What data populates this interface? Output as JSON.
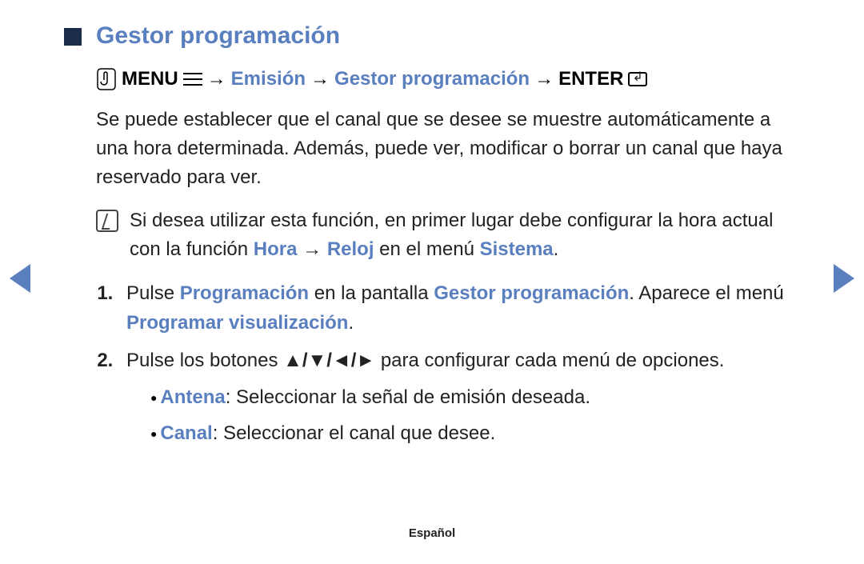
{
  "title": "Gestor programación",
  "path": {
    "menu": "MENU",
    "step1": "Emisión",
    "step2": "Gestor programación",
    "enter": "ENTER",
    "arrow": "→"
  },
  "intro": "Se puede establecer que el canal que se desee se muestre automáticamente a una hora determinada. Además, puede ver, modificar o borrar un canal que haya reservado para ver.",
  "note": {
    "pre": "Si desea utilizar esta función, en primer lugar debe configurar la hora actual con la función ",
    "hora": "Hora",
    "arrow": "→",
    "reloj": "Reloj",
    "mid": " en el menú ",
    "sistema": "Sistema",
    "end": "."
  },
  "steps": {
    "s1": {
      "t1": "Pulse ",
      "prog": "Programación",
      "t2": " en la pantalla ",
      "gestor": "Gestor programación",
      "t3": ". Aparece el menú ",
      "pv": "Programar visualización",
      "t4": "."
    },
    "s2": {
      "t1": "Pulse los botones ",
      "arrows": "▲/▼/◄/►",
      "t2": " para configurar cada menú de opciones."
    }
  },
  "bullets": {
    "antena_label": "Antena",
    "antena_text": ": Seleccionar la señal de emisión deseada.",
    "canal_label": "Canal",
    "canal_text": ": Seleccionar el canal que desee."
  },
  "footer": "Español"
}
